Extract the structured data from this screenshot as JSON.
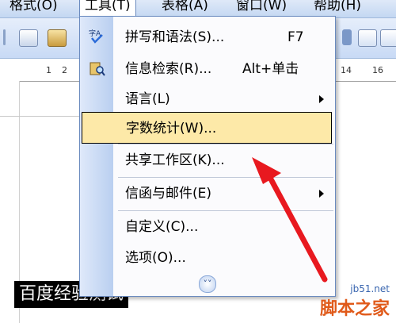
{
  "menubar": {
    "items": [
      {
        "label": "格式(O)"
      },
      {
        "label": "工具(T)"
      },
      {
        "label": "表格(A)"
      },
      {
        "label": "窗口(W)"
      },
      {
        "label": "帮助(H)"
      }
    ]
  },
  "ruler": {
    "ticks": [
      "1",
      "2",
      "14",
      "16"
    ]
  },
  "menu": {
    "items": [
      {
        "label": "拼写和语法(S)...",
        "shortcut": "F7",
        "icon": "spelling-check-icon"
      },
      {
        "label": "信息检索(R)...",
        "shortcut": "Alt+单击",
        "icon": "research-icon"
      },
      {
        "label": "语言(L)",
        "submenu": true
      },
      {
        "label": "字数统计(W)...",
        "highlighted": true
      },
      {
        "label": "共享工作区(K)..."
      },
      {
        "label": "信函与邮件(E)",
        "submenu": true
      },
      {
        "label": "自定义(C)..."
      },
      {
        "label": "选项(O)..."
      }
    ],
    "expand_icon": "chevron-double-down-icon"
  },
  "document": {
    "selected_text": "百度经验测试"
  },
  "annotation": {
    "arrow_color": "#e8191f"
  },
  "watermark": {
    "site": "jb51.net",
    "brand": "脚本之家"
  }
}
